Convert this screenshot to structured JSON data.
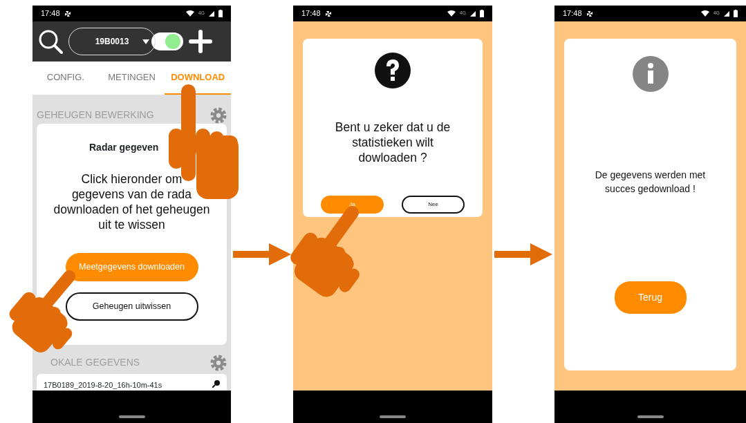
{
  "screen_1": {
    "status_bar": {
      "time": "17:48",
      "network": "4G"
    },
    "header": {
      "device": "19B0013",
      "toggle_on": true
    },
    "tabs": [
      {
        "label": "CONFIG.",
        "selected": false
      },
      {
        "label": "METINGEN",
        "selected": false
      },
      {
        "label": "DOWNLOAD",
        "selected": true
      }
    ],
    "memory_section": {
      "title": "GEHEUGEN BEWERKING",
      "card_title": "Radar gegeven",
      "card_text": "Click hieronder om\ngegevens van de rada\ndownloaden of het geheugen\nuit te wissen",
      "buttons": [
        {
          "label": "Meetgegevens downloaden",
          "kind": "primary"
        },
        {
          "label": "Geheugen uitwissen",
          "kind": "outline"
        }
      ]
    },
    "local_section": {
      "title": "OKALE GEGEVENS",
      "files": [
        "17B0189_2019-8-20_16h-10m-41s"
      ]
    }
  },
  "screen_2": {
    "status_bar": {
      "time": "17:48",
      "network": "4G"
    },
    "dialog": {
      "kind": "question",
      "message": "Bent u zeker dat u de statistieken wilt dowloaden ?",
      "buttons": [
        {
          "label": "Ja",
          "kind": "primary"
        },
        {
          "label": "Nee",
          "kind": "outline"
        }
      ]
    }
  },
  "screen_3": {
    "status_bar": {
      "time": "17:48",
      "network": "4G"
    },
    "dialog": {
      "kind": "info",
      "message": "De gegevens werden met succes gedownload !",
      "buttons": [
        {
          "label": "Terug",
          "kind": "primary"
        }
      ]
    }
  }
}
